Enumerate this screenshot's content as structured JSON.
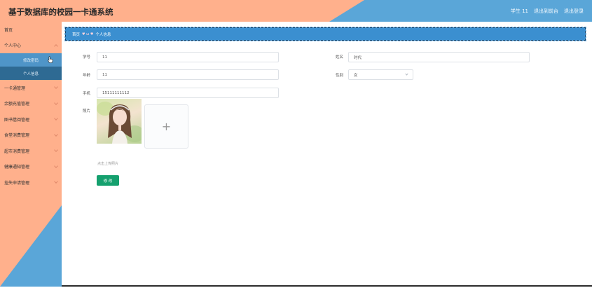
{
  "header": {
    "title": "基于数据库的校园一卡通系统",
    "user": "学生 11",
    "links": [
      "退出到前台",
      "退出登录"
    ]
  },
  "sidebar": {
    "items": [
      {
        "label": "首页"
      },
      {
        "label": "个人中心"
      },
      {
        "label": "一卡通管理"
      },
      {
        "label": "余额充值管理"
      },
      {
        "label": "图书借阅管理"
      },
      {
        "label": "食堂消费管理"
      },
      {
        "label": "超市消费管理"
      },
      {
        "label": "健康通知管理"
      },
      {
        "label": "挂失申请管理"
      }
    ],
    "sub_items": [
      {
        "label": "修改密码"
      },
      {
        "label": "个人信息"
      }
    ]
  },
  "breadcrumb": {
    "home": "首页",
    "hearts": "♥ ω ♥",
    "current": "个人信息"
  },
  "form": {
    "xuehao": {
      "label": "学号",
      "value": "11"
    },
    "xingming": {
      "label": "姓名",
      "value": "时代"
    },
    "nianling": {
      "label": "年龄",
      "value": "11"
    },
    "xingbie": {
      "label": "性别",
      "value": "女"
    },
    "shouji": {
      "label": "手机",
      "value": "15111111112"
    },
    "zhaopian": {
      "label": "照片"
    },
    "upload_tip": "点击上传照片",
    "submit": "修 改"
  },
  "colors": {
    "peach": "#ffb08c",
    "blue": "#5aa6d8",
    "dark_blue": "#2e6a93",
    "button": "#15a06e"
  }
}
